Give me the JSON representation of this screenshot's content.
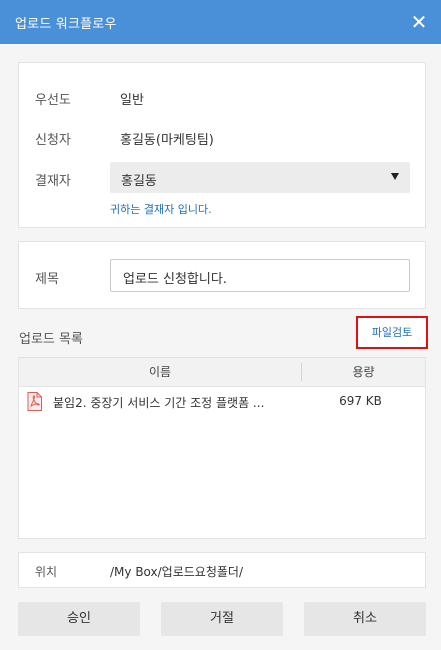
{
  "dialog": {
    "title": "업로드 워크플로우",
    "close_glyph": "✕"
  },
  "info": {
    "priority_label": "우선도",
    "priority_value": "일반",
    "requester_label": "신청자",
    "requester_value": "홍길동(마케팅팀)",
    "approver_label": "결재자",
    "approver_selected": "홍길동",
    "approver_note": "귀하는 결재자 입니다."
  },
  "subject": {
    "label": "제목",
    "value": "업로드 신청합니다."
  },
  "upload_list": {
    "title": "업로드 목록",
    "check_files_button": "파일검토",
    "columns": {
      "name": "이름",
      "size": "용량"
    },
    "rows": [
      {
        "name": "붙임2. 중장기 서비스 기간 조정 플랫폼 ...",
        "size": "697 KB",
        "icon": "pdf-icon"
      }
    ]
  },
  "location": {
    "label": "위치",
    "value": "/My Box/업로드요청폴더/"
  },
  "buttons": {
    "approve": "승인",
    "reject": "거절",
    "cancel": "취소"
  },
  "colors": {
    "titlebar": "#4a90d9",
    "link": "#1f6fbf",
    "highlight_border": "#e01010",
    "pdf_icon": "#e05a4f"
  }
}
